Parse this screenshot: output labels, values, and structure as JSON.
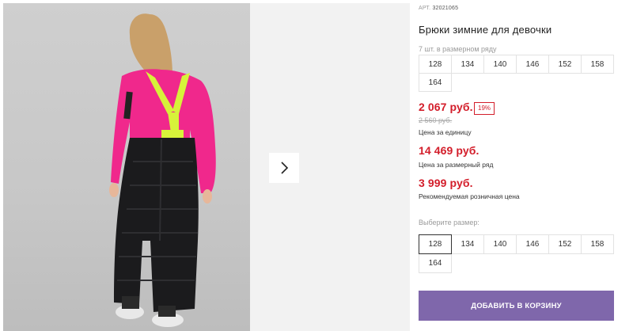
{
  "product": {
    "article_label": "АРТ.",
    "article_value": "32021065",
    "title": "Брюки зимние для девочки",
    "pack_note": "7 шт. в размерном ряду"
  },
  "size_row": [
    "128",
    "134",
    "140",
    "146",
    "152",
    "158",
    "164"
  ],
  "pricing": {
    "unit_price": "2 067 руб.",
    "discount_badge": "19%",
    "old_price": "2 560 руб.",
    "unit_caption": "Цена за единицу",
    "row_price": "14 469 руб.",
    "row_caption": "Цена за размерный ряд",
    "retail_price": "3 999 руб.",
    "retail_caption": "Рекомендуемая розничная цена"
  },
  "size_select": {
    "label": "Выберите размер:",
    "options": [
      "128",
      "134",
      "140",
      "146",
      "152",
      "158",
      "164"
    ],
    "selected": "128"
  },
  "cart_button_label": "ДОБАВИТЬ В КОРЗИНУ",
  "colors": {
    "price_red": "#d31d2a",
    "button_purple": "#7f67ab",
    "shirt_pink": "#f0288c",
    "suspender_yellow": "#d7f23a",
    "pants_black": "#1b1b1d"
  },
  "icons": {
    "next": "chevron-right-icon"
  }
}
